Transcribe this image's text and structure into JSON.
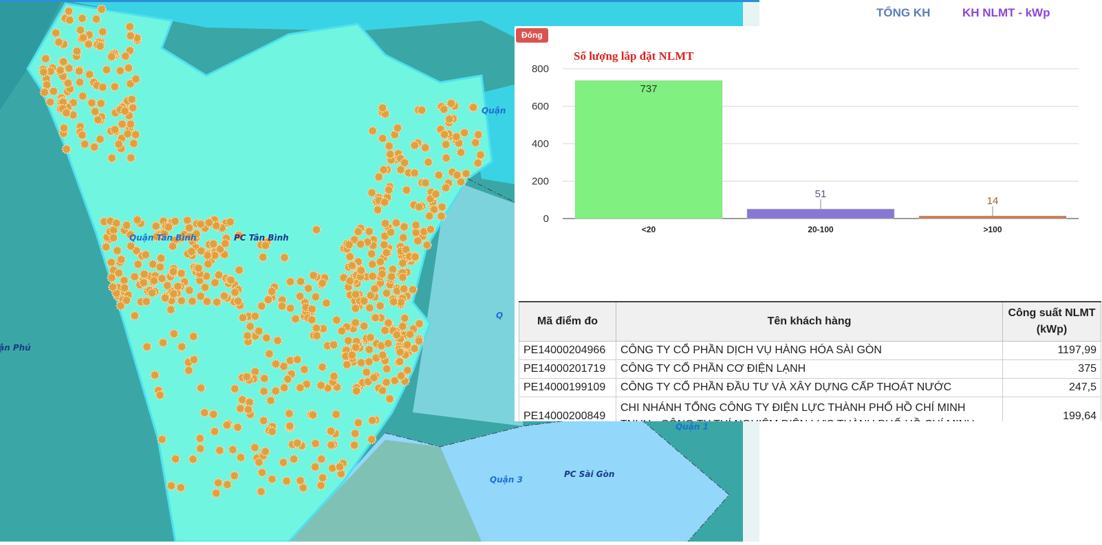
{
  "map": {
    "labels": {
      "quan_tan_binh": "Quận Tân Bình",
      "pc_tan_binh": "PC Tân Bình",
      "quan_partial_top": "Quận",
      "quan_partial_mid": "Q",
      "tan_phu_partial": "ận Phú",
      "quan_1": "Quận 1",
      "quan_3": "Quận 3",
      "pc_sai_gon": "PC Sài Gòn"
    },
    "colors": {
      "highlight_region": "#70f5e0",
      "marker": "#e0a040",
      "water": "#3ad3e6",
      "district_teal": "#3aa7a6",
      "quan1": "#93d7fb"
    }
  },
  "tabs": {
    "tong_kh": "TỔNG KH",
    "kh_nlmt": "KH NLMT - kWp"
  },
  "popup": {
    "close_label": "Đóng",
    "chart_title": "Số lượng lắp đặt NLMT"
  },
  "chart_data": {
    "type": "bar",
    "title": "Số lượng lắp đặt NLMT",
    "categories": [
      "<20",
      "20-100",
      ">100"
    ],
    "values": [
      737,
      51,
      14
    ],
    "colors": [
      "#80f080",
      "#8878d0",
      "#c87850"
    ],
    "ylim": [
      0,
      800
    ],
    "yticks": [
      0,
      200,
      400,
      600,
      800
    ],
    "grid": true
  },
  "table": {
    "headers": [
      "Mã điểm đo",
      "Tên khách hàng",
      "Công suất NLMT (kWp)"
    ],
    "rows": [
      [
        "PE14000204966",
        "CÔNG TY CỔ PHẦN DỊCH VỤ HÀNG HÓA SÀI GÒN",
        "1197,99"
      ],
      [
        "PE14000201719",
        "CÔNG TY CỔ PHẦN CƠ ĐIỆN LẠNH",
        "375"
      ],
      [
        "PE14000199109",
        "CÔNG TY CỔ PHẦN ĐẦU TƯ VÀ XÂY DỰNG CẤP THOÁT NƯỚC",
        "247,5"
      ],
      [
        "PE14000200849",
        "CHI NHÁNH TỔNG CÔNG TY ĐIỆN LỰC THÀNH PHỐ HỒ CHÍ MINH TNHH - CÔNG TY THÍ NGHIỆM ĐIỆN LỰC THÀNH PHỐ HỒ CHÍ MINH",
        "199,64"
      ]
    ]
  }
}
